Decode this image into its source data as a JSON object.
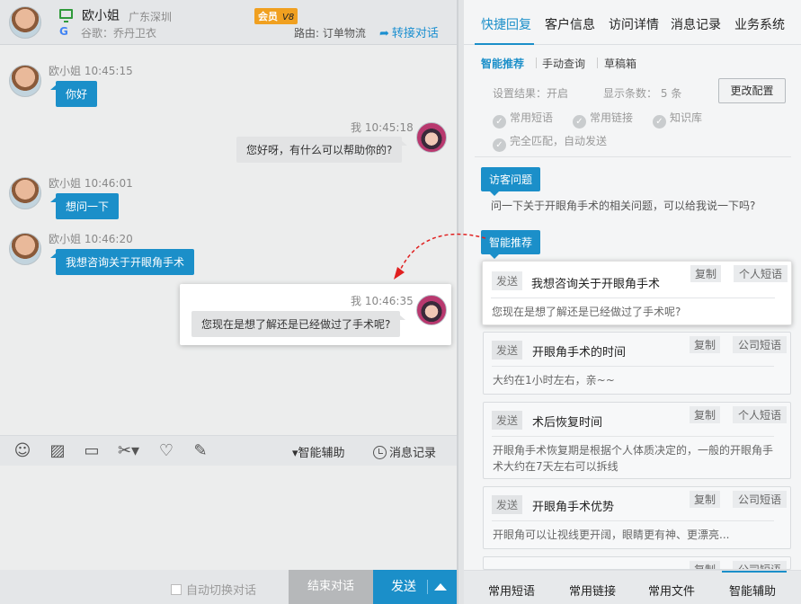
{
  "header": {
    "name": "欧小姐",
    "location": "广东深圳",
    "badge": "会员",
    "badge_level": "V8",
    "source": "谷歌：乔丹卫衣",
    "route": "路由: 订单物流",
    "transfer": "转接对话"
  },
  "messages": [
    {
      "meta": "欧小姐 10:45:15",
      "text": "你好"
    },
    {
      "meta": "我 10:45:18",
      "text": "您好呀，有什么可以帮助你的?"
    },
    {
      "meta": "欧小姐 10:46:01",
      "text": "想问一下"
    },
    {
      "meta": "欧小姐 10:46:20",
      "text": "我想咨询关于开眼角手术"
    },
    {
      "meta": "我 10:46:35",
      "text": "您现在是想了解还是已经做过了手术呢?"
    }
  ],
  "toolbar": {
    "assist": "智能辅助",
    "history": "消息记录"
  },
  "footer": {
    "auto_switch": "自动切换对话",
    "end": "结束对话",
    "send": "发送"
  },
  "right_tabs": [
    "快捷回复",
    "客户信息",
    "访问详情",
    "消息记录",
    "业务系统"
  ],
  "sub_tabs": [
    "智能推荐",
    "手动查询",
    "草稿箱"
  ],
  "config": {
    "result": "设置结果：开启",
    "count": "显示条数：",
    "count_num": "5",
    "count_unit": "条",
    "button": "更改配置",
    "checks": [
      "常用短语",
      "常用链接",
      "知识库",
      "完全匹配，自动发送"
    ]
  },
  "visitor_tag": "访客问题",
  "visitor_question": "问一下关于开眼角手术的相关问题，可以给我说一下吗?",
  "smart_tag": "智能推荐",
  "cards": [
    {
      "send": "发送",
      "title": "我想咨询关于开眼角手术",
      "copy": "复制",
      "kind": "个人短语",
      "body": "您现在是想了解还是已经做过了手术呢?"
    },
    {
      "send": "发送",
      "title": "开眼角手术的时间",
      "copy": "复制",
      "kind": "公司短语",
      "body": "大约在1小时左右，亲~~"
    },
    {
      "send": "发送",
      "title": "术后恢复时间",
      "copy": "复制",
      "kind": "个人短语",
      "body": "开眼角手术恢复期是根据个人体质决定的，一般的开眼角手术大约在7天左右可以拆线"
    },
    {
      "send": "发送",
      "title": "开眼角手术优势",
      "copy": "复制",
      "kind": "公司短语",
      "body": "开眼角可以让视线更开阔，眼睛更有神、更漂亮..."
    },
    {
      "send": "",
      "title": "",
      "copy": "复制",
      "kind": "公司短语",
      "body": ""
    }
  ],
  "right_footer": [
    "常用短语",
    "常用链接",
    "常用文件",
    "智能辅助"
  ]
}
